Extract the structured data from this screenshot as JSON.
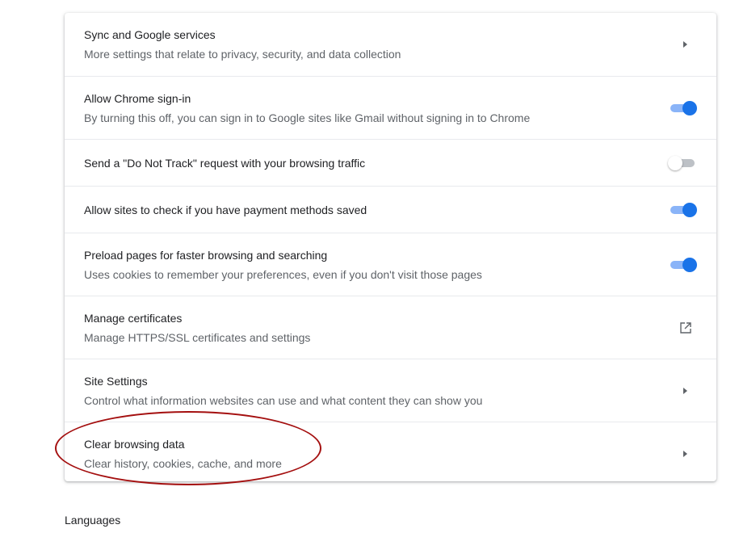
{
  "settings": [
    {
      "title": "Sync and Google services",
      "subtitle": "More settings that relate to privacy, security, and data collection",
      "control": "arrow"
    },
    {
      "title": "Allow Chrome sign-in",
      "subtitle": "By turning this off, you can sign in to Google sites like Gmail without signing in to Chrome",
      "control": "toggle",
      "on": true
    },
    {
      "title": "Send a \"Do Not Track\" request with your browsing traffic",
      "control": "toggle",
      "on": false
    },
    {
      "title": "Allow sites to check if you have payment methods saved",
      "control": "toggle",
      "on": true
    },
    {
      "title": "Preload pages for faster browsing and searching",
      "subtitle": "Uses cookies to remember your preferences, even if you don't visit those pages",
      "control": "toggle",
      "on": true
    },
    {
      "title": "Manage certificates",
      "subtitle": "Manage HTTPS/SSL certificates and settings",
      "control": "external-link-icon"
    },
    {
      "title": "Site Settings",
      "subtitle": "Control what information websites can use and what content they can show you",
      "control": "arrow"
    },
    {
      "title": "Clear browsing data",
      "subtitle": "Clear history, cookies, cache, and more",
      "control": "arrow"
    }
  ],
  "section_heading": "Languages",
  "colors": {
    "toggle_on": "#1a73e8",
    "toggle_on_track": "#8ab4f8",
    "annotation_circle": "#a40f0f"
  }
}
